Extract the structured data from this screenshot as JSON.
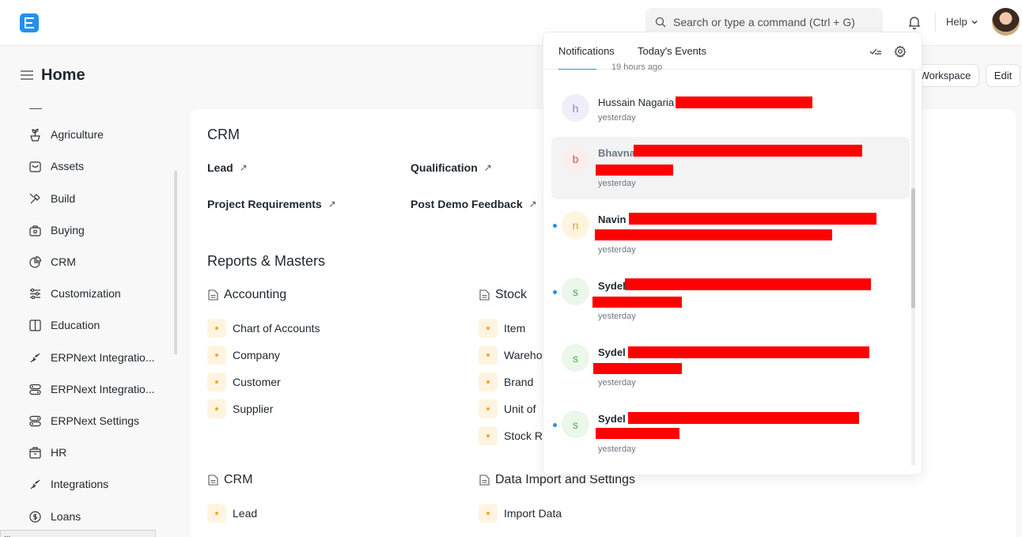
{
  "navbar": {
    "search_placeholder": "Search or type a command (Ctrl + G)",
    "help_label": "Help"
  },
  "page": {
    "title": "Home",
    "workspace_btn": "Workspace",
    "edit_btn": "Edit"
  },
  "sidebar": {
    "items": [
      {
        "label": "Agriculture",
        "icon": "agriculture-icon"
      },
      {
        "label": "Assets",
        "icon": "assets-icon"
      },
      {
        "label": "Build",
        "icon": "build-icon"
      },
      {
        "label": "Buying",
        "icon": "buying-icon"
      },
      {
        "label": "CRM",
        "icon": "crm-icon"
      },
      {
        "label": "Customization",
        "icon": "customization-icon"
      },
      {
        "label": "Education",
        "icon": "education-icon"
      },
      {
        "label": "ERPNext Integratio...",
        "icon": "integration-icon"
      },
      {
        "label": "ERPNext Integratio...",
        "icon": "integration-settings-icon"
      },
      {
        "label": "ERPNext Settings",
        "icon": "settings-icon"
      },
      {
        "label": "HR",
        "icon": "hr-icon"
      },
      {
        "label": "Integrations",
        "icon": "integrations-icon"
      },
      {
        "label": "Loans",
        "icon": "loans-icon"
      }
    ],
    "status_url": "..."
  },
  "main": {
    "crm_heading": "CRM",
    "shortcuts": [
      "Lead",
      "Qualification",
      "Project Requirements",
      "Post Demo Feedback"
    ],
    "reports_heading": "Reports & Masters",
    "sections": {
      "accounting": {
        "title": "Accounting",
        "links": [
          "Chart of Accounts",
          "Company",
          "Customer",
          "Supplier"
        ]
      },
      "stock": {
        "title": "Stock",
        "links": [
          "Item",
          "Wareho",
          "Brand",
          "Unit of",
          "Stock R"
        ]
      },
      "crm": {
        "title": "CRM",
        "links": [
          "Lead"
        ]
      },
      "data_import": {
        "title": "Data Import and Settings",
        "links": [
          "Import Data"
        ]
      }
    }
  },
  "notifications": {
    "tabs": [
      "Notifications",
      "Today's Events"
    ],
    "partial_text": "19 hours ago",
    "items": [
      {
        "initial": "h",
        "name": "Hussain Nagaria",
        "time": "yesterday",
        "unread": false,
        "color": "#8b7fd6",
        "bg": "#f0eefb"
      },
      {
        "initial": "b",
        "name": "Bhavna",
        "time": "yesterday",
        "unread": false,
        "color": "#e24c4c",
        "bg": "#fdeeee"
      },
      {
        "initial": "n",
        "name": "Navin",
        "time": "yesterday",
        "unread": true,
        "color": "#e0a030",
        "bg": "#fff4de"
      },
      {
        "initial": "s",
        "name": "Sydel",
        "time": "yesterday",
        "unread": true,
        "color": "#4caf50",
        "bg": "#eaf7ea"
      },
      {
        "initial": "s",
        "name": "Sydel",
        "time": "yesterday",
        "unread": false,
        "color": "#4caf50",
        "bg": "#eaf7ea"
      },
      {
        "initial": "s",
        "name": "Sydel",
        "time": "yesterday",
        "unread": true,
        "color": "#4caf50",
        "bg": "#eaf7ea"
      }
    ]
  },
  "colors": {
    "accent": "#2490ef",
    "redaction": "#ff0000"
  }
}
